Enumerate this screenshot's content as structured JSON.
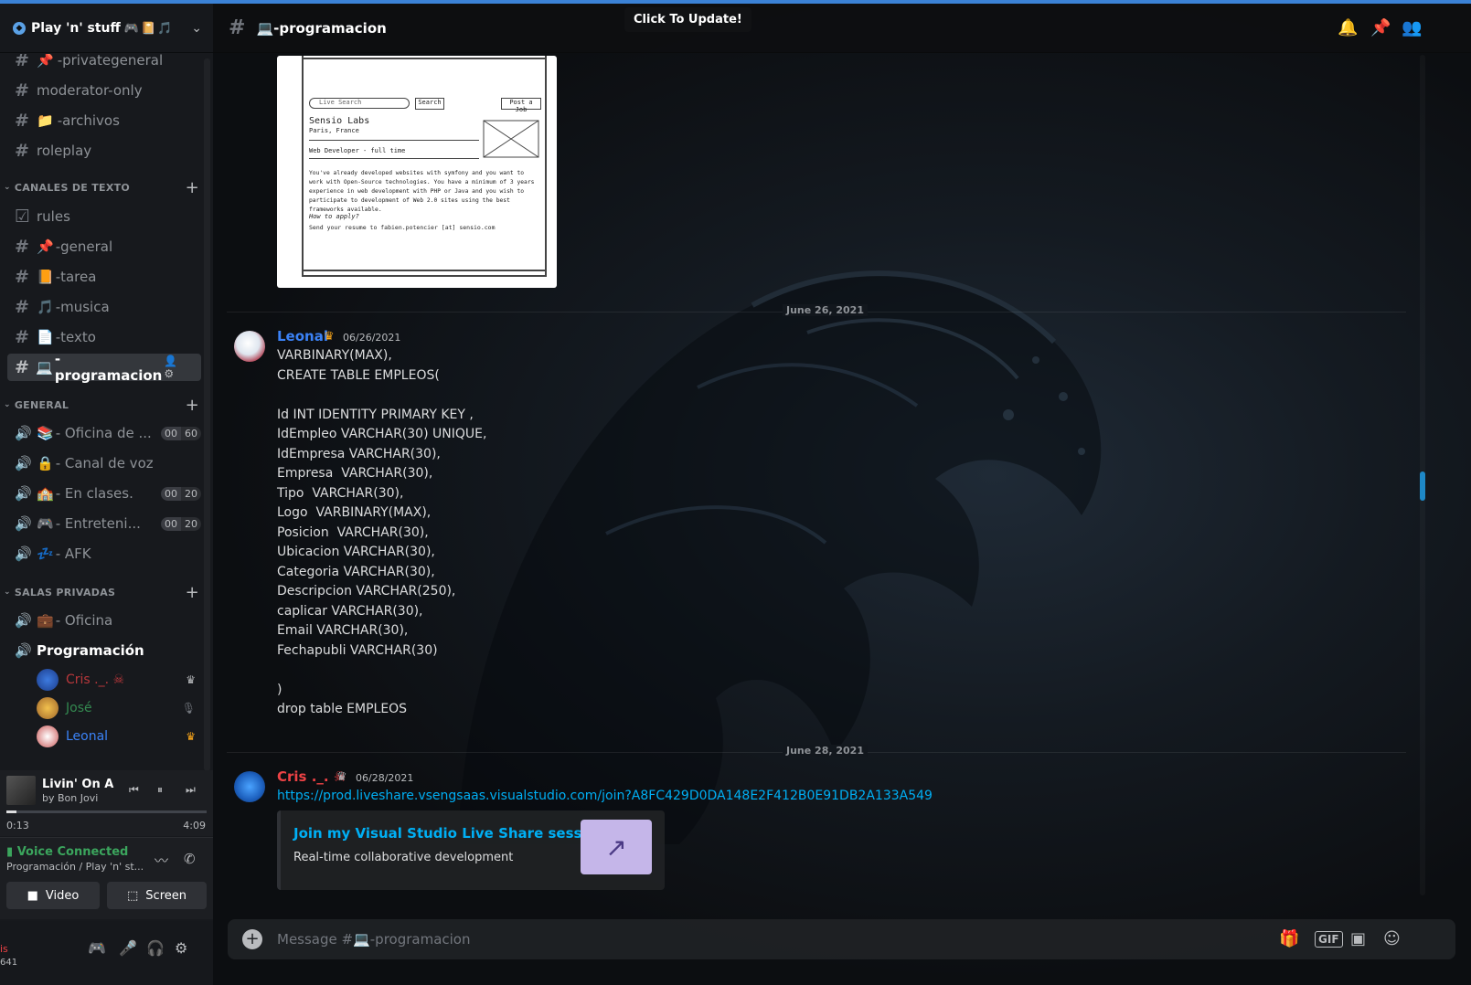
{
  "guild": {
    "name": "Play 'n' stuff",
    "emojis": "🎮📔🎵"
  },
  "channels_top": [
    {
      "name": "-privategeneral",
      "emoji": "📌"
    },
    {
      "name": "moderator-only",
      "emoji": ""
    },
    {
      "name": "-archivos",
      "emoji": "📁"
    },
    {
      "name": "roleplay",
      "emoji": ""
    }
  ],
  "categories": {
    "text": "CANALES DE TEXTO",
    "general": "GENERAL",
    "private": "SALAS PRIVADAS"
  },
  "text_channels": [
    {
      "name": "rules",
      "emoji": "",
      "icon": "rules-icon"
    },
    {
      "name": "-general",
      "emoji": "📌"
    },
    {
      "name": "-tarea",
      "emoji": "📙"
    },
    {
      "name": "-musica",
      "emoji": "🎵"
    },
    {
      "name": "-texto",
      "emoji": "📄"
    },
    {
      "name": "-programacion",
      "emoji": "💻",
      "active": true
    }
  ],
  "voice_channels": [
    {
      "name": "- Oficina de ...",
      "emoji": "📚",
      "pill": [
        "00",
        "60"
      ]
    },
    {
      "name": "- Canal de voz",
      "emoji": "🔒"
    },
    {
      "name": "- En clases.",
      "emoji": "🏫",
      "pill": [
        "00",
        "20"
      ]
    },
    {
      "name": "- Entreteni...",
      "emoji": "🎮",
      "pill": [
        "00",
        "20"
      ]
    },
    {
      "name": "- AFK",
      "emoji": "💤"
    }
  ],
  "private_channels": [
    {
      "name": "- Oficina",
      "emoji": "💼"
    },
    {
      "name": "Programación",
      "emoji": ""
    }
  ],
  "voice_members": [
    {
      "name": "Cris ._. ☠",
      "color": "#ed4245"
    },
    {
      "name": "José",
      "color": "#3ba55d"
    },
    {
      "name": "Leonal",
      "color": "#3b82f6"
    }
  ],
  "music": {
    "song": "Livin' On A Prayer",
    "artist": "by Bon Jovi",
    "current": "0:13",
    "total": "4:09",
    "progress": 0.05
  },
  "voice": {
    "status": "Voice Connected",
    "location": "Programación / Play 'n' st...",
    "video_label": "Video",
    "screen_label": "Screen"
  },
  "user": {
    "name": "is",
    "tag": "641"
  },
  "header": {
    "channel": "💻-programacion",
    "tooltip": "Click To Update!"
  },
  "dates": {
    "d1": "June 26, 2021",
    "d2": "June 28, 2021"
  },
  "messages": [
    {
      "author": "Leonal",
      "color": "#3b82f6",
      "timestamp": "06/26/2021",
      "lines": [
        "VARBINARY(MAX),",
        "CREATE TABLE EMPLEOS(",
        "",
        "Id INT IDENTITY PRIMARY KEY ,",
        "IdEmpleo VARCHAR(30) UNIQUE,",
        "IdEmpresa VARCHAR(30),",
        "Empresa  VARCHAR(30),",
        "Tipo  VARCHAR(30),",
        "Logo  VARBINARY(MAX),",
        "Posicion  VARCHAR(30),",
        "Ubicacion VARCHAR(30),",
        "Categoria VARCHAR(30),",
        "Descripcion VARCHAR(250),",
        "caplicar VARCHAR(30),",
        "Email VARCHAR(30),",
        "Fechapubli VARCHAR(30)",
        "",
        ")",
        "drop table EMPLEOS"
      ]
    },
    {
      "author": "Cris ._. ☠",
      "color": "#ed4245",
      "timestamp": "06/28/2021",
      "link": "https://prod.liveshare.vsengsaas.visualstudio.com/join?A8FC429D0DA148E2F412B0E91DB2A133A549",
      "embed": {
        "title": "Join my Visual Studio Live Share session",
        "description": "Real-time collaborative development"
      }
    }
  ],
  "attachment": {
    "search_placeholder": "Live Search",
    "search_button": "Search",
    "post_button": "Post a Job",
    "company": "Sensio Labs",
    "location": "Paris, France",
    "job": "Web Developer - full time",
    "body": "You've already developed websites with symfony and you want to work with Open-Source technologies. You have a minimum of 3 years experience in web development with PHP or Java and you wish to participate to development of Web 2.0 sites using the best frameworks available.",
    "apply_q": "How to apply?",
    "apply": "Send your resume to fabien.potencier [at] sensio.com"
  },
  "composer": {
    "placeholder": "Message #💻-programacion"
  },
  "colors": {
    "accent": "#3b82d6",
    "link": "#00aff4",
    "online": "#3ba55d"
  }
}
